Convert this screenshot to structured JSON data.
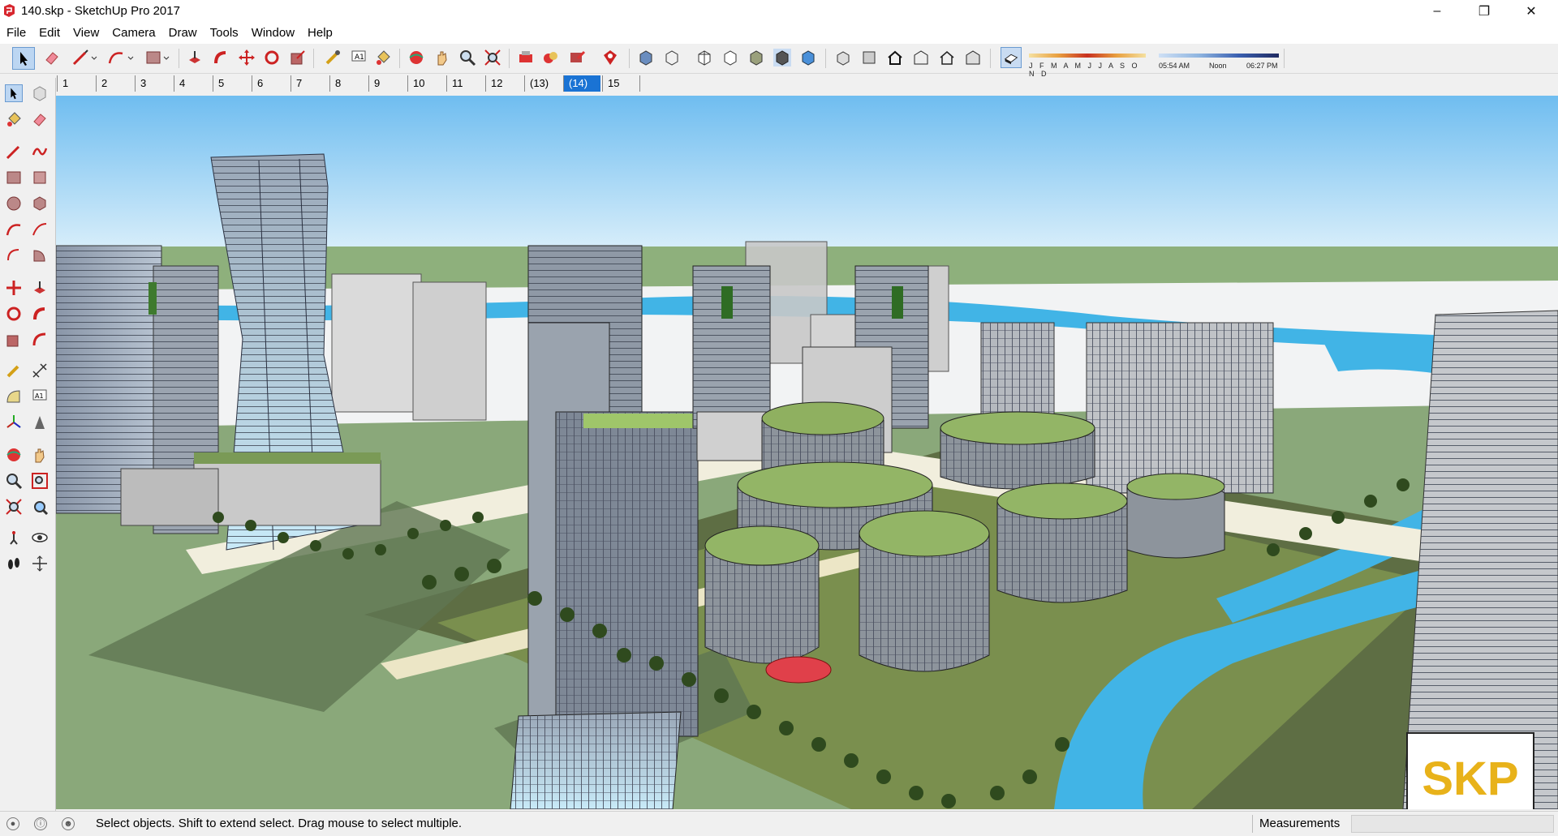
{
  "window": {
    "title": "140.skp - SketchUp Pro 2017"
  },
  "menu": [
    "File",
    "Edit",
    "View",
    "Camera",
    "Draw",
    "Tools",
    "Window",
    "Help"
  ],
  "scenes": {
    "tabs": [
      "1",
      "2",
      "3",
      "4",
      "5",
      "6",
      "7",
      "8",
      "9",
      "10",
      "11",
      "12",
      "(13)",
      "(14)",
      "15"
    ],
    "active_index": 13
  },
  "shadows": {
    "months": "J F M A M J J A S O N D",
    "time_start": "05:54 AM",
    "time_mid": "Noon",
    "time_end": "06:27 PM"
  },
  "status": {
    "message": "Select objects. Shift to extend select. Drag mouse to select multiple.",
    "measurements_label": "Measurements",
    "measurements_value": ""
  },
  "watermark": "SKP",
  "colors": {
    "accent": "#1a73d4",
    "sky_top": "#7ec3f0",
    "water": "#41b4e6",
    "grass": "#8aa87a"
  }
}
